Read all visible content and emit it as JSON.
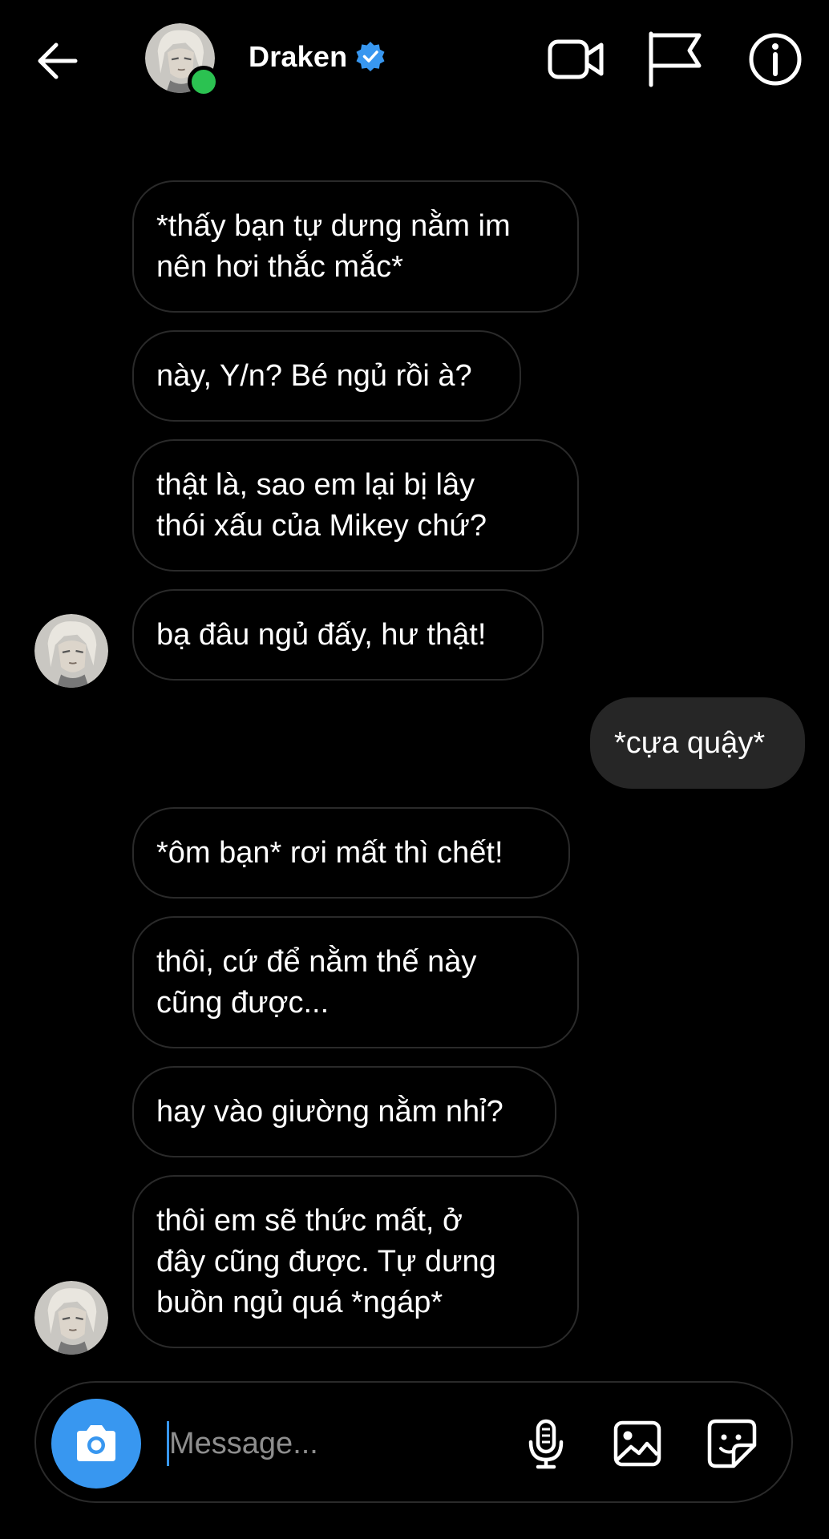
{
  "header": {
    "contact_name": "Draken",
    "verified": true,
    "online": true
  },
  "icons": {
    "back": "arrow-left-icon",
    "video": "video-call-icon",
    "flag": "flag-icon",
    "info": "info-icon",
    "camera": "camera-icon",
    "mic": "microphone-icon",
    "gallery": "image-icon",
    "sticker": "sticker-icon"
  },
  "colors": {
    "background": "#000000",
    "accent": "#3897f0",
    "online": "#2bc251",
    "own_bubble": "#262626"
  },
  "messages": [
    {
      "from": "contact",
      "text": "*thấy bạn tự dưng nằm im\nnên hơi thắc mắc*"
    },
    {
      "from": "contact",
      "text": "này, Y/n? Bé ngủ rồi à?"
    },
    {
      "from": "contact",
      "text": "thật là, sao em lại bị lây\nthói xấu của Mikey chứ?"
    },
    {
      "from": "contact",
      "text": "bạ đâu ngủ đấy, hư thật!"
    },
    {
      "from": "me",
      "text": "*cựa quậy*"
    },
    {
      "from": "contact",
      "text": "*ôm bạn* rơi mất thì chết!"
    },
    {
      "from": "contact",
      "text": "thôi, cứ để nằm thế này\ncũng được..."
    },
    {
      "from": "contact",
      "text": "hay vào giường nằm nhỉ?"
    },
    {
      "from": "contact",
      "text": "thôi em sẽ thức mất, ở\nđây cũng được. Tự dưng\nbuồn ngủ quá *ngáp*"
    }
  ],
  "composer": {
    "placeholder": "Message..."
  }
}
